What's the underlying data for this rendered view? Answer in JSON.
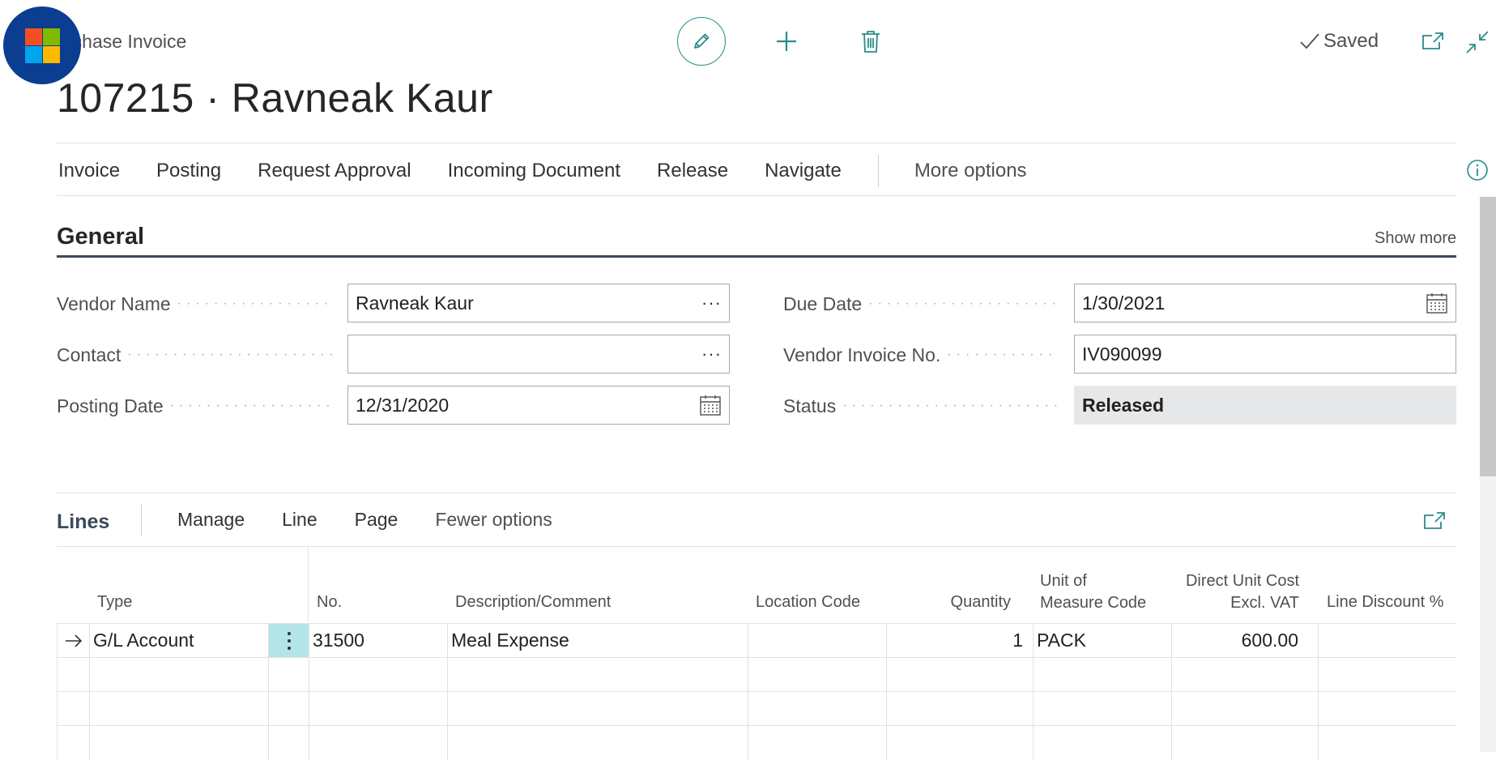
{
  "header": {
    "page_type": "rchase Invoice",
    "page_title": "107215 · Ravneak Kaur",
    "saved_label": "Saved"
  },
  "actions": {
    "items": [
      "Invoice",
      "Posting",
      "Request Approval",
      "Incoming Document",
      "Release",
      "Navigate"
    ],
    "more": "More options"
  },
  "general": {
    "title": "General",
    "show_more": "Show more",
    "vendor_name": {
      "label": "Vendor Name",
      "value": "Ravneak Kaur"
    },
    "contact": {
      "label": "Contact",
      "value": ""
    },
    "posting_date": {
      "label": "Posting Date",
      "value": "12/31/2020"
    },
    "due_date": {
      "label": "Due Date",
      "value": "1/30/2021"
    },
    "vendor_invoice_no": {
      "label": "Vendor Invoice No.",
      "value": "IV090099"
    },
    "status": {
      "label": "Status",
      "value": "Released"
    }
  },
  "lines": {
    "title": "Lines",
    "actions": [
      "Manage",
      "Line",
      "Page"
    ],
    "fewer": "Fewer options",
    "columns": {
      "type": "Type",
      "no": "No.",
      "description": "Description/Comment",
      "location": "Location Code",
      "quantity": "Quantity",
      "uom_1": "Unit of",
      "uom_2": "Measure Code",
      "cost_1": "Direct Unit Cost",
      "cost_2": "Excl. VAT",
      "discount": "Line Discount %"
    },
    "rows": [
      {
        "type": "G/L Account",
        "no": "31500",
        "description": "Meal Expense",
        "location": "",
        "quantity": "1",
        "uom": "PACK",
        "cost": "600.00",
        "discount": ""
      }
    ]
  },
  "colors": {
    "accent": "#2b8a8a",
    "logo_bg": "#0b3d91",
    "selected_cell": "#b3e5e8",
    "status_bg": "#e6e7e8"
  }
}
